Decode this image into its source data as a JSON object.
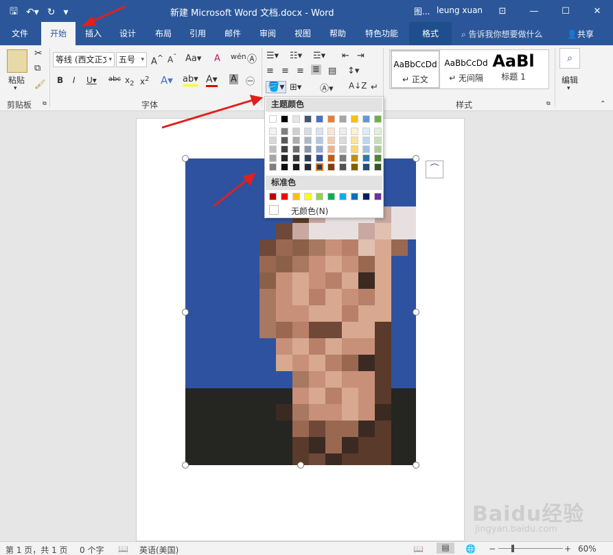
{
  "window": {
    "title": "新建 Microsoft Word 文档.docx  -  Word",
    "context_label": "图...",
    "user": "leung xuan"
  },
  "tabs": [
    "文件",
    "开始",
    "插入",
    "设计",
    "布局",
    "引用",
    "邮件",
    "审阅",
    "视图",
    "帮助",
    "特色功能",
    "格式"
  ],
  "tell_me": "告诉我你想要做什么",
  "share": "共享",
  "ribbon": {
    "clipboard": {
      "paste": "粘贴",
      "label": "剪贴板"
    },
    "font": {
      "name": "等线 (西文正文)",
      "size": "五号",
      "label": "字体"
    },
    "styles": {
      "label": "样式",
      "items": [
        {
          "sample": "AaBbCcDd",
          "name": "↵ 正文"
        },
        {
          "sample": "AaBbCcDd",
          "name": "↵ 无间隔"
        },
        {
          "sample": "AaBl",
          "name": "标题 1"
        }
      ]
    },
    "editing": {
      "label": "编辑"
    }
  },
  "color_dropdown": {
    "theme_label": "主题颜色",
    "standard_label": "标准色",
    "no_color_label": "无颜色(N)",
    "theme_top_row": [
      "#ffffff",
      "#000000",
      "#e7e6e6",
      "#44546a",
      "#4472c4",
      "#ed7d31",
      "#a5a5a5",
      "#ffc000",
      "#5b9bd5",
      "#70ad47"
    ],
    "theme_shades": [
      [
        "#f2f2f2",
        "#7f7f7f",
        "#d0cece",
        "#d6dce4",
        "#d9e2f3",
        "#fbe5d5",
        "#ededed",
        "#fff2cc",
        "#deebf6",
        "#e2efd9"
      ],
      [
        "#d8d8d8",
        "#595959",
        "#aeabab",
        "#adb9ca",
        "#b4c6e7",
        "#f7cbac",
        "#dbdbdb",
        "#fee599",
        "#bdd7ee",
        "#c5e0b3"
      ],
      [
        "#bfbfbf",
        "#3f3f3f",
        "#757070",
        "#8496b0",
        "#8eaadb",
        "#f4b183",
        "#c9c9c9",
        "#ffd965",
        "#9cc3e5",
        "#a8d08d"
      ],
      [
        "#a5a5a5",
        "#262626",
        "#3a3838",
        "#323f4f",
        "#2f5496",
        "#c55a11",
        "#7b7b7b",
        "#bf9000",
        "#2e75b5",
        "#538135"
      ],
      [
        "#7f7f7f",
        "#0c0c0c",
        "#171616",
        "#222a35",
        "#1f3864",
        "#833c0b",
        "#525252",
        "#7f6000",
        "#1e4e79",
        "#375623"
      ]
    ],
    "standard_colors": [
      "#c00000",
      "#ff0000",
      "#ffc000",
      "#ffff00",
      "#92d050",
      "#00b050",
      "#00b0f0",
      "#0070c0",
      "#002060",
      "#7030a0"
    ],
    "selected": "#1f3864"
  },
  "status": {
    "page": "第 1 页，共 1 页",
    "words": "0 个字",
    "language": "英语(美国)",
    "zoom": "60%"
  },
  "watermark": {
    "logo": "Baidu经验",
    "url": "jingyan.baidu.com"
  },
  "colors": {
    "accent": "#2b579a",
    "photo_bg": "#2e52a0",
    "arrow": "#e0201c"
  }
}
